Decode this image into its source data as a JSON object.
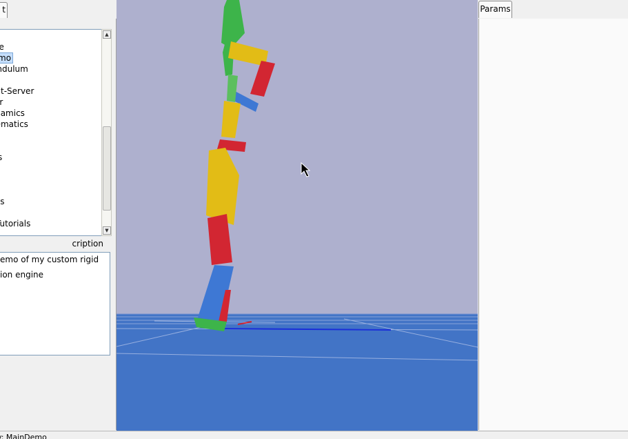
{
  "left_tab": {
    "label": "t"
  },
  "demo_tree": {
    "items": [
      {
        "label": "gine",
        "selected": false
      },
      {
        "label": "mo",
        "selected": true
      },
      {
        "label": "endulum",
        "selected": false
      },
      {
        "label": "",
        "selected": false
      },
      {
        "label": "ent-Server",
        "selected": false
      },
      {
        "label": "er",
        "selected": false
      },
      {
        "label": "ynamics",
        "selected": false
      },
      {
        "label": "nematics",
        "selected": false
      },
      {
        "label": "",
        "selected": false
      },
      {
        "label": "",
        "selected": false
      },
      {
        "label": "ks",
        "selected": false
      },
      {
        "label": "",
        "selected": false
      },
      {
        "label": "",
        "selected": false
      },
      {
        "label": "",
        "selected": false
      },
      {
        "label": "nts",
        "selected": false
      },
      {
        "label": "l",
        "selected": false
      },
      {
        "label": "Tutorials",
        "selected": false
      }
    ]
  },
  "description": {
    "label": "cription",
    "lines": [
      "emo of my custom rigid",
      "ion engine"
    ]
  },
  "params_tab": {
    "label": "Params"
  },
  "status": {
    "text": "y: MainDemo"
  },
  "colors": {
    "sky": "#aeb0ce",
    "ground": "#4274c6",
    "limb_green": "#3db44a",
    "limb_yellow": "#e2bc16",
    "limb_red": "#d22632",
    "limb_blue": "#3e78d4"
  }
}
